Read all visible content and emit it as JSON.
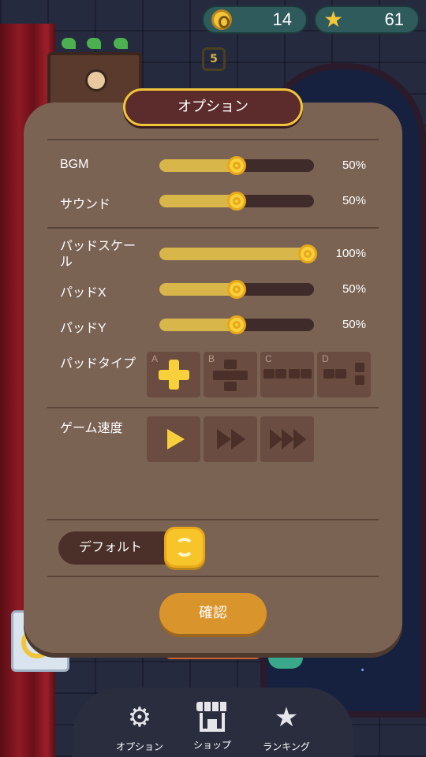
{
  "counters": {
    "coins": "14",
    "stars": "61"
  },
  "scene": {
    "level_number": "5"
  },
  "options": {
    "title": "オプション",
    "rows": {
      "bgm": {
        "label": "BGM",
        "value_text": "50%",
        "level": 0.5
      },
      "sound": {
        "label": "サウンド",
        "value_text": "50%",
        "level": 0.5
      },
      "pad_scale": {
        "label": "パッドスケール",
        "value_text": "100%",
        "level": 1.0
      },
      "pad_x": {
        "label": "パッドX",
        "value_text": "50%",
        "level": 0.5
      },
      "pad_y": {
        "label": "パッドY",
        "value_text": "50%",
        "level": 0.5
      }
    },
    "pad_type": {
      "label": "パッドタイプ",
      "selected": "A",
      "options": [
        "A",
        "B",
        "C",
        "D"
      ]
    },
    "game_speed": {
      "label": "ゲーム速度",
      "selected": 1,
      "options": [
        "play",
        "fast-forward",
        "fastest-forward"
      ]
    },
    "default_label": "デフォルト",
    "confirm_label": "確認"
  },
  "nav": {
    "options_label": "オプション",
    "shop_label": "ショップ",
    "ranking_label": "ランキング"
  },
  "colors": {
    "panel": "#7b6354",
    "accent_gold": "#f7d03c",
    "slider_fill": "#d8b64a",
    "slider_track": "#3f2b2a",
    "confirm": "#d9952c"
  }
}
